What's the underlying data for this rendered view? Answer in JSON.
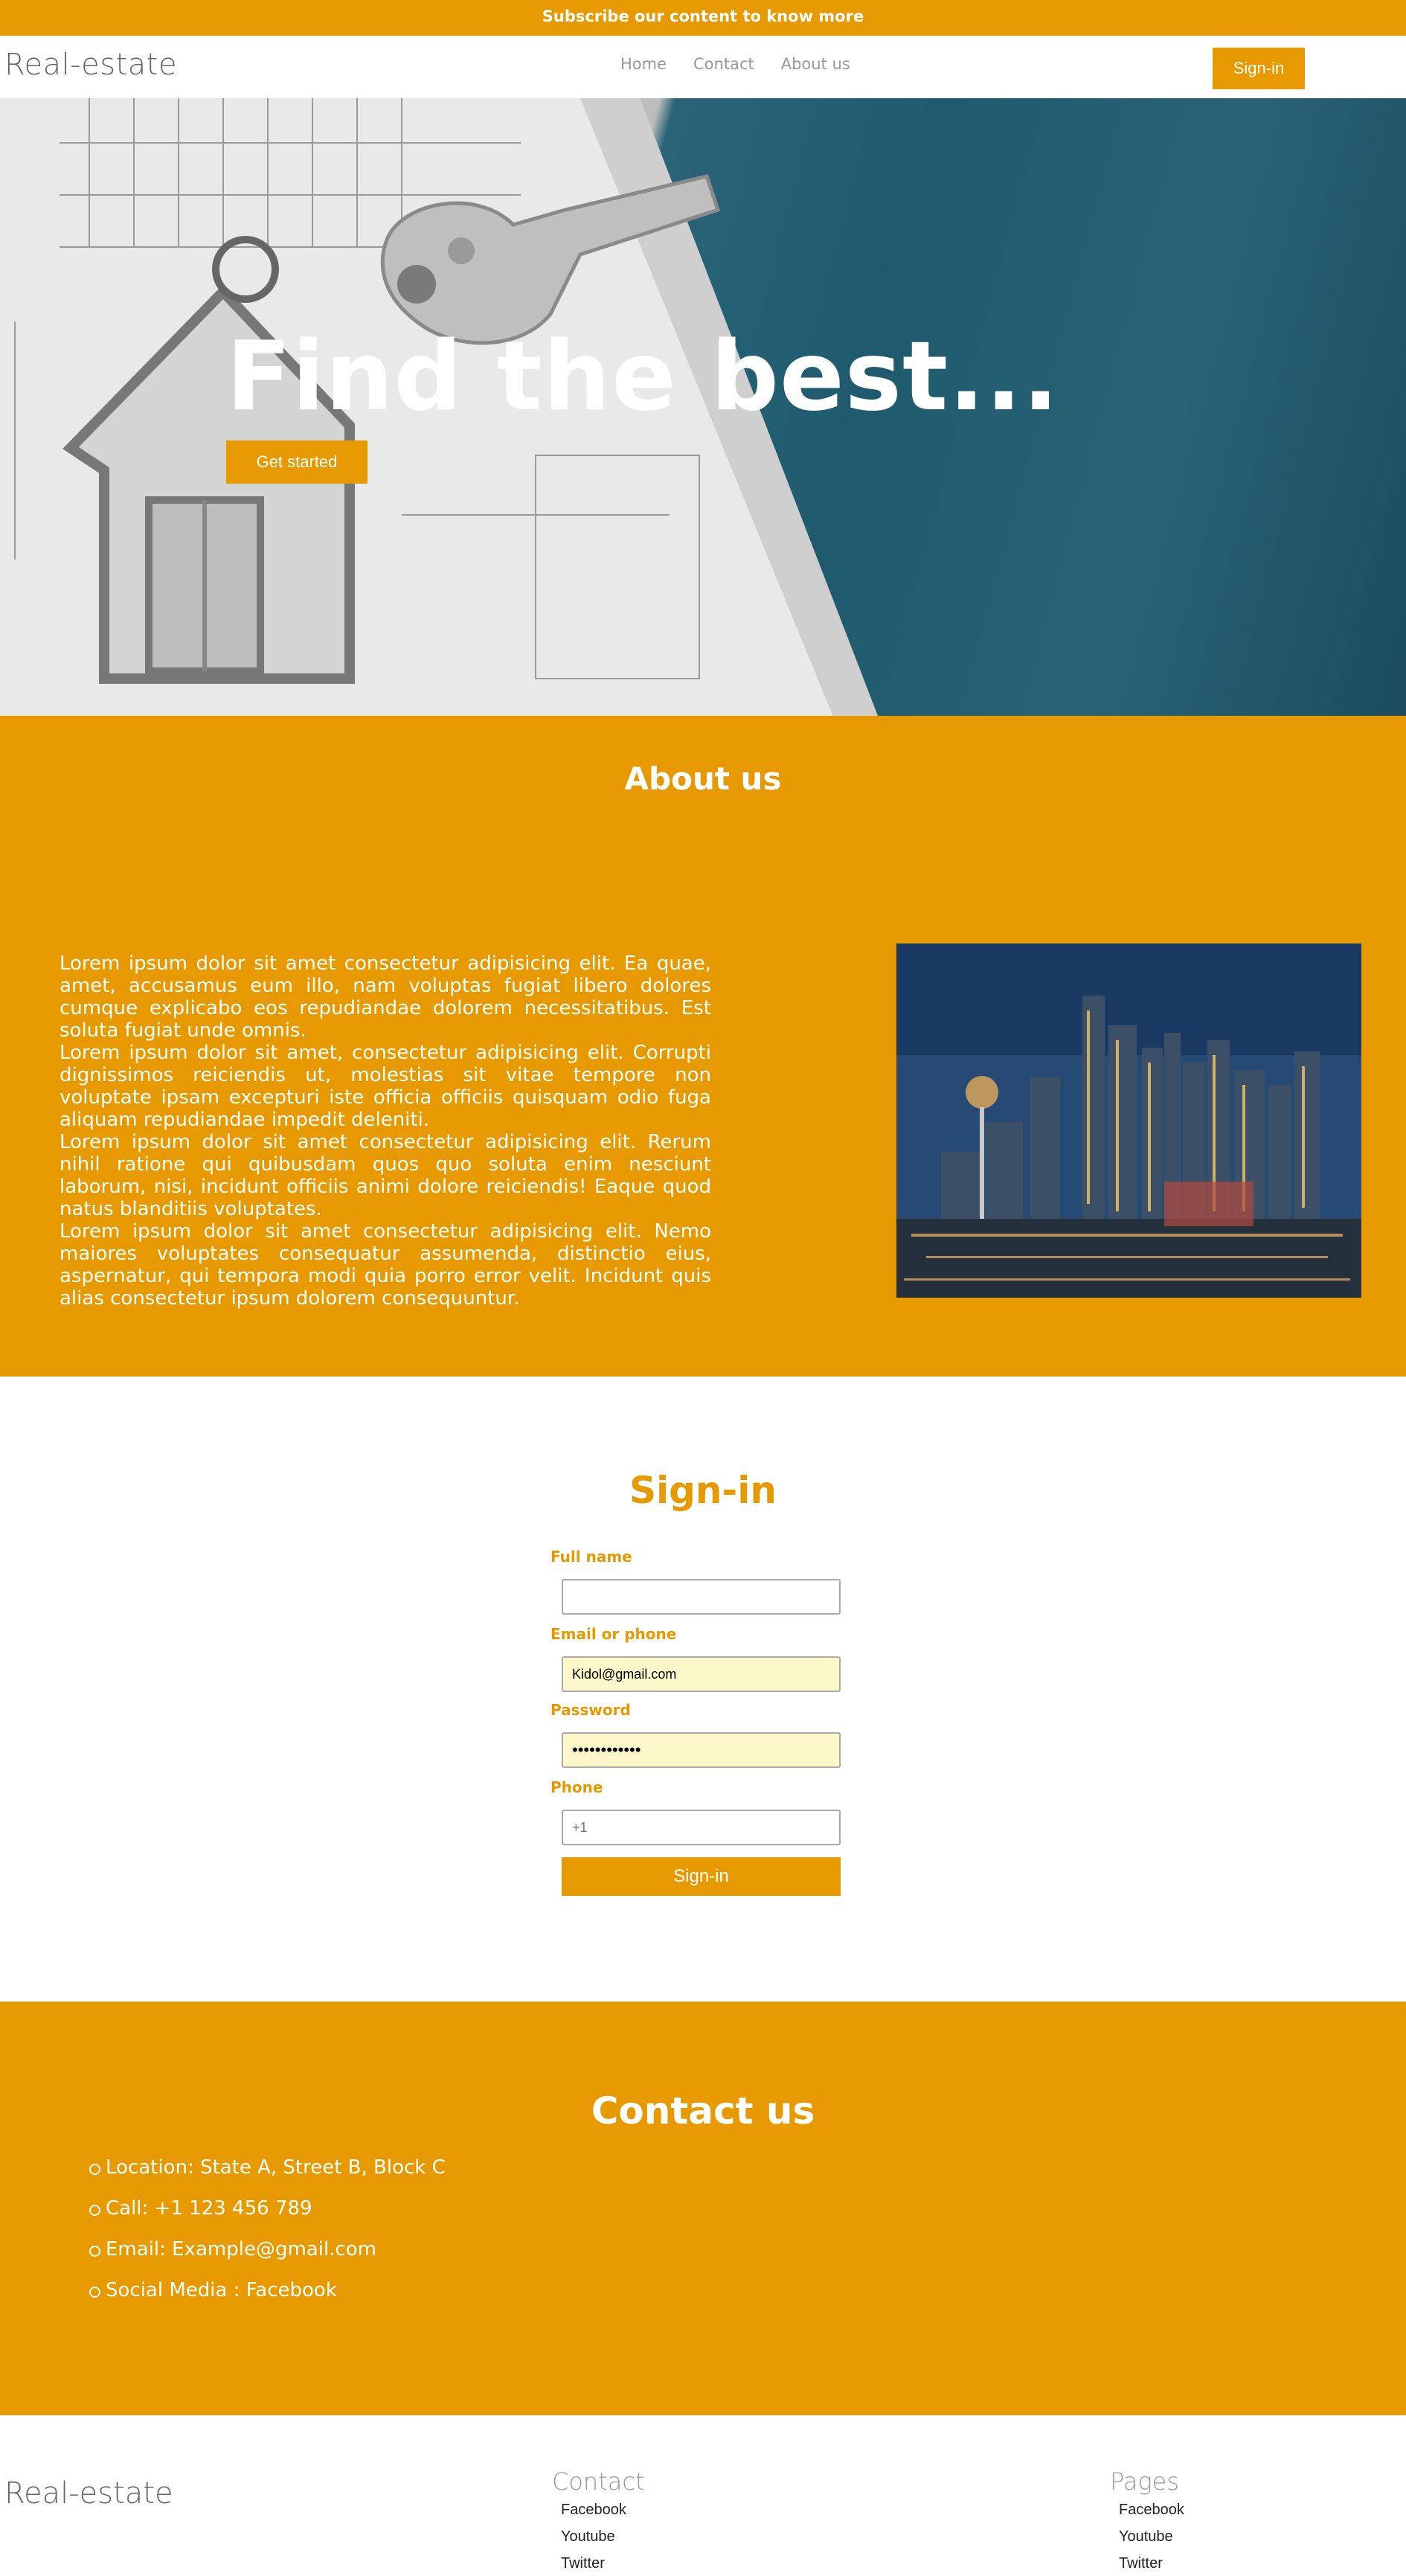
{
  "topbar": {
    "text": "Subscribe our content to know more"
  },
  "header": {
    "logo": "Real-estate",
    "nav": [
      {
        "label": "Home"
      },
      {
        "label": "Contact"
      },
      {
        "label": "About us"
      }
    ],
    "signin_label": "Sign-in"
  },
  "hero": {
    "title": "Find the best...",
    "button_label": "Get started"
  },
  "about": {
    "title": "About us",
    "paragraphs": [
      "Lorem ipsum dolor sit amet consectetur adipisicing elit. Ea quae, amet, accusamus eum illo, nam voluptas fugiat libero dolores cumque explicabo eos repudiandae dolorem necessitatibus. Est soluta fugiat unde omnis.",
      "Lorem ipsum dolor sit amet, consectetur adipisicing elit. Corrupti dignissimos reiciendis ut, molestias sit vitae tempore non voluptate ipsam excepturi iste officia officiis quisquam odio fuga aliquam repudiandae impedit deleniti.",
      "Lorem ipsum dolor sit amet consectetur adipisicing elit. Rerum nihil ratione qui quibusdam quos quo soluta enim nesciunt laborum, nisi, incidunt officiis animi dolore reiciendis! Eaque quod natus blanditiis voluptates.",
      "Lorem ipsum dolor sit amet consectetur adipisicing elit. Nemo maiores voluptates consequatur assumenda, distinctio eius, aspernatur, qui tempora modi quia porro error velit. Incidunt quis alias consectetur ipsum dolorem consequuntur."
    ]
  },
  "signin": {
    "title": "Sign-in",
    "fields": [
      {
        "label": "Full name",
        "value": "",
        "placeholder": ""
      },
      {
        "label": "Email or phone",
        "value": "Kidol@gmail.com",
        "placeholder": ""
      },
      {
        "label": "Password",
        "value": "••••••••••••",
        "placeholder": ""
      },
      {
        "label": "Phone",
        "value": "",
        "placeholder": "+1"
      }
    ],
    "submit_label": "Sign-in"
  },
  "contact": {
    "title": "Contact us",
    "items": [
      "Location: State A, Street B, Block C",
      "Call: +1 123 456 789",
      "Email: Example@gmail.com",
      "Social Media : Facebook"
    ]
  },
  "footer": {
    "logo": "Real-estate",
    "columns": [
      {
        "title": "Contact",
        "links": [
          "Facebook",
          "Youtube",
          "Twitter"
        ]
      },
      {
        "title": "Pages",
        "links": [
          "Facebook",
          "Youtube",
          "Twitter"
        ]
      }
    ]
  },
  "colors": {
    "accent": "#e69900",
    "white": "#ffffff",
    "text_muted": "#999999"
  }
}
